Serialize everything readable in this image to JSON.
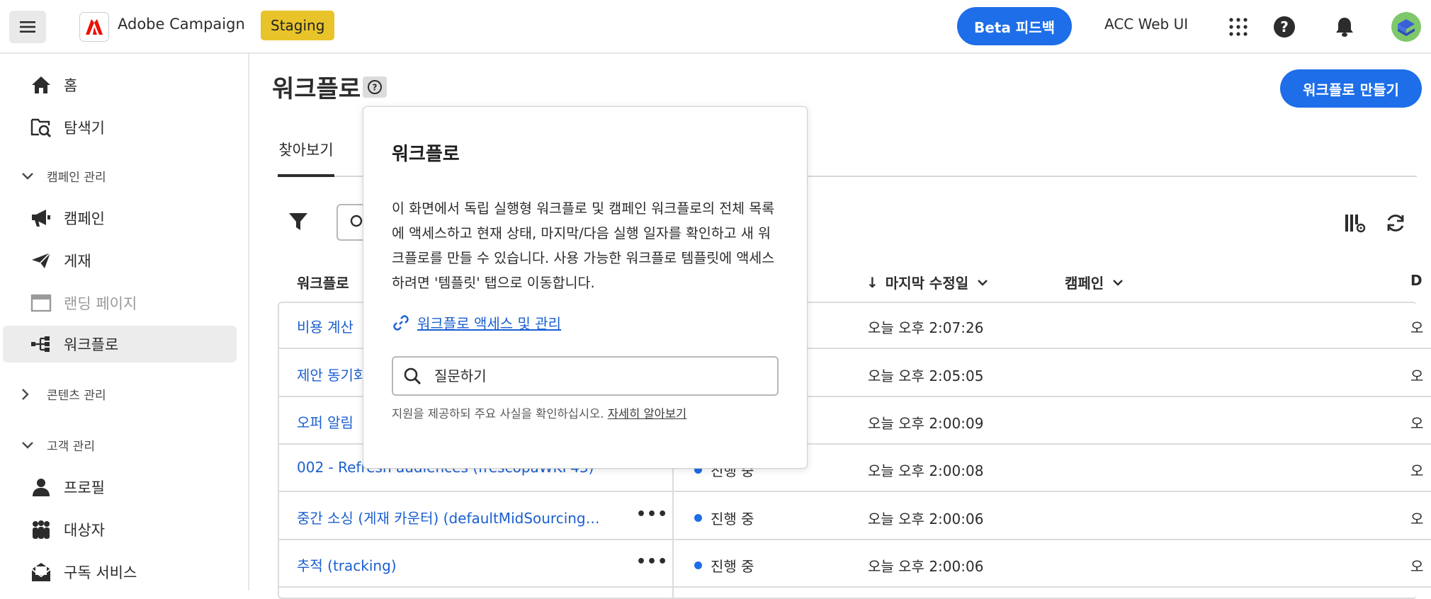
{
  "topbar": {
    "app_name": "Adobe Campaign",
    "env_badge": "Staging",
    "beta_feedback": "Beta 피드백",
    "acc_web_ui": "ACC Web UI"
  },
  "sidebar": {
    "home": "홈",
    "explorer": "탐색기",
    "section_campaign": "캠페인 관리",
    "campaigns": "캠페인",
    "deliveries": "게재",
    "landing_pages": "랜딩 페이지",
    "workflows": "워크플로",
    "section_content": "콘텐츠 관리",
    "section_customer": "고객 관리",
    "profiles": "프로필",
    "audiences": "대상자",
    "subscriptions": "구독 서비스"
  },
  "main": {
    "title": "워크플로",
    "create_button": "워크플로 만들기",
    "tab_browse": "찾아보기",
    "columns": {
      "workflow": "워크플로",
      "last_modified": "마지막 수정일",
      "campaign": "캠페인",
      "last_modified_sort": "↓"
    },
    "rows": [
      {
        "name": "비용 계산",
        "status": "",
        "modified": "오늘 오후 2:07:26"
      },
      {
        "name": "제안 동기화",
        "status": "",
        "modified": "오늘 오후 2:05:05"
      },
      {
        "name": "오퍼 알림",
        "status": "",
        "modified": "오늘 오후 2:00:09"
      },
      {
        "name": "002 - Refresh audiences (frescopaWKF43)",
        "status": "진행 중",
        "modified": "오늘 오후 2:00:08"
      },
      {
        "name": "중간 소싱 (게재 카운터) (defaultMidSourcing…",
        "status": "진행 중",
        "modified": "오늘 오후 2:00:06"
      },
      {
        "name": "추적 (tracking)",
        "status": "진행 중",
        "modified": "오늘 오후 2:00:06"
      }
    ],
    "more_label": "•••",
    "edge_char": "오",
    "edge_header": "D"
  },
  "popover": {
    "title": "워크플로",
    "body": "이 화면에서 독립 실행형 워크플로 및 캠페인 워크플로의 전체 목록에 액세스하고 현재 상태, 마지막/다음 실행 일자를 확인하고 새 워크플로를 만들 수 있습니다. 사용 가능한 워크플로 템플릿에 액세스하려면 '템플릿' 탭으로 이동합니다.",
    "link": "워크플로 액세스 및 관리",
    "search_placeholder": "질문하기",
    "disclaimer": "지원을 제공하되 주요 사실을 확인하십시오.",
    "learn_more": "자세히 알아보기"
  },
  "colors": {
    "accent": "#1d6ee8",
    "link": "#1a5fd0",
    "staging": "#e8c42a"
  }
}
